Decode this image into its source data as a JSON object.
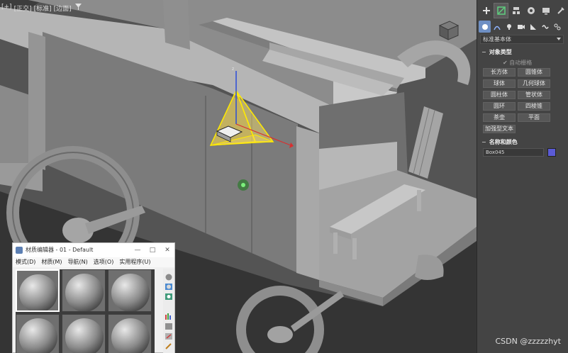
{
  "viewport": {
    "labels": [
      "[+]",
      "[正交]",
      "[标准]",
      "[边面]"
    ],
    "filter_icon": "funnel-icon"
  },
  "command_panel": {
    "tabs": [
      "create-icon",
      "modify-icon",
      "hierarchy-icon",
      "motion-icon",
      "display-icon",
      "utilities-icon"
    ],
    "categories": [
      "geometry-icon",
      "shapes-icon",
      "lights-icon",
      "cameras-icon",
      "helpers-icon",
      "spacewarps-icon",
      "systems-icon"
    ],
    "dropdown": "标准基本体",
    "object_type": {
      "title": "对象类型",
      "autogrid": "自动栅格",
      "buttons": [
        "长方体",
        "圆锥体",
        "球体",
        "几何球体",
        "圆柱体",
        "管状体",
        "圆环",
        "四棱锥",
        "茶壶",
        "平面",
        "加强型文本"
      ]
    },
    "name_color": {
      "title": "名称和颜色",
      "name_value": "Box045",
      "color": "#5b5bd6"
    }
  },
  "material_editor": {
    "title": "材质编辑器 - 01 - Default",
    "window_buttons": [
      "—",
      "□",
      "✕"
    ],
    "menu": [
      "模式(D)",
      "材质(M)",
      "导航(N)",
      "选项(O)",
      "实用程序(U)"
    ]
  },
  "watermark": "CSDN @zzzzzhyt"
}
